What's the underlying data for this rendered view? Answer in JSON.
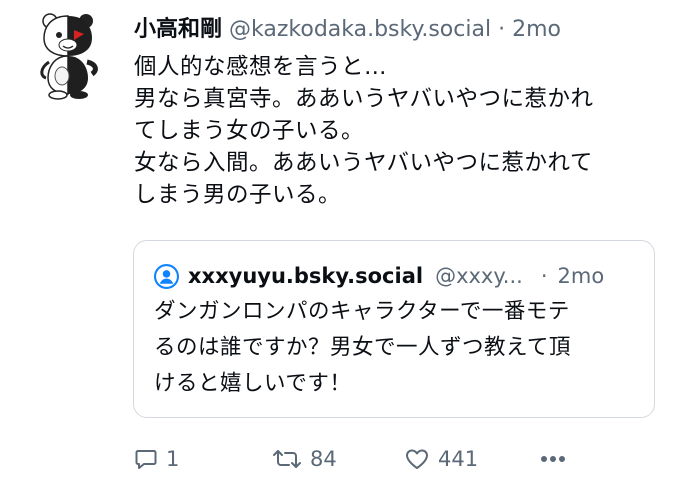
{
  "post": {
    "display_name": "小高和剛",
    "handle": "@kazkodaka.bsky.social",
    "separator": "·",
    "time": "2mo",
    "text_lines": [
      "個人的な感想を言うと…",
      "男なら真宮寺。ああいうヤバいやつに惹かれ",
      "てしまう女の子いる。",
      "女なら入間。ああいうヤバいやつに惹かれて",
      "しまう男の子いる。"
    ]
  },
  "quote": {
    "display_name": "xxxyuyu.bsky.social",
    "handle": "@xxxy...",
    "separator": "·",
    "time": "2mo",
    "text_lines": [
      "ダンガンロンパのキャラクターで一番モテ",
      "るのは誰ですか？男女で一人ずつ教えて頂",
      "けると嬉しいです！"
    ]
  },
  "actions": {
    "reply_count": "1",
    "repost_count": "84",
    "like_count": "441"
  },
  "icons": {
    "reply": "speech-bubble-icon",
    "repost": "repost-arrows-icon",
    "like": "heart-icon",
    "more": "ellipsis-icon",
    "quote_avatar": "default-user-avatar-icon"
  },
  "colors": {
    "text": "#0b0f14",
    "muted": "#5b6877",
    "border": "#d4d9df",
    "accent": "#1083fe"
  }
}
